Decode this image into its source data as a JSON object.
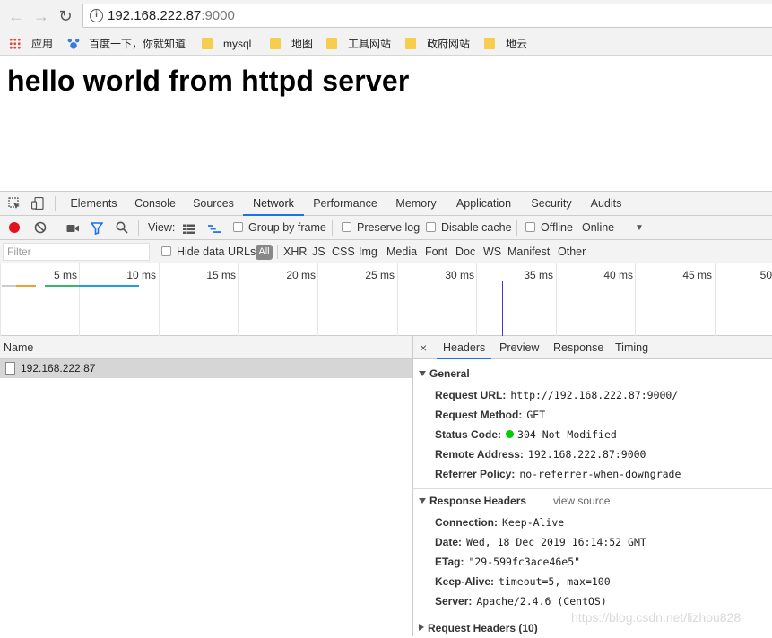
{
  "browser": {
    "url_host": "192.168.222.87",
    "url_port": ":9000",
    "bookmarks": [
      {
        "label": "应用",
        "icon": "apps-grid-icon"
      },
      {
        "label": "百度一下，你就知道",
        "icon": "baidu-paw-icon"
      },
      {
        "label": "mysql",
        "icon": "folder-icon"
      },
      {
        "label": "地图",
        "icon": "folder-icon"
      },
      {
        "label": "工具网站",
        "icon": "folder-icon"
      },
      {
        "label": "政府网站",
        "icon": "folder-icon"
      },
      {
        "label": "地云",
        "icon": "folder-icon"
      }
    ]
  },
  "page": {
    "heading": "hello world from httpd server"
  },
  "devtools": {
    "tabs": [
      "Elements",
      "Console",
      "Sources",
      "Network",
      "Performance",
      "Memory",
      "Application",
      "Security",
      "Audits"
    ],
    "active_tab": "Network",
    "toolbar": {
      "view_label": "View:",
      "group_by_frame": "Group by frame",
      "preserve_log": "Preserve log",
      "disable_cache": "Disable cache",
      "offline": "Offline",
      "throttle": "Online"
    },
    "filter": {
      "placeholder": "Filter",
      "hide_data_urls": "Hide data URLs",
      "types": [
        "All",
        "XHR",
        "JS",
        "CSS",
        "Img",
        "Media",
        "Font",
        "Doc",
        "WS",
        "Manifest",
        "Other"
      ]
    },
    "timeline_ticks": [
      "5 ms",
      "10 ms",
      "15 ms",
      "20 ms",
      "25 ms",
      "30 ms",
      "35 ms",
      "40 ms",
      "45 ms",
      "50"
    ],
    "requests": {
      "column_name": "Name",
      "rows": [
        "192.168.222.87"
      ]
    },
    "detail": {
      "tabs": [
        "Headers",
        "Preview",
        "Response",
        "Timing"
      ],
      "active_tab": "Headers",
      "close_glyph": "×",
      "general": {
        "title": "General",
        "items": [
          {
            "k": "Request URL:",
            "v": "http://192.168.222.87:9000/"
          },
          {
            "k": "Request Method:",
            "v": "GET"
          },
          {
            "k": "Status Code:",
            "v": "304 Not Modified"
          },
          {
            "k": "Remote Address:",
            "v": "192.168.222.87:9000"
          },
          {
            "k": "Referrer Policy:",
            "v": "no-referrer-when-downgrade"
          }
        ]
      },
      "response_headers": {
        "title": "Response Headers",
        "view_source": "view source",
        "items": [
          {
            "k": "Connection:",
            "v": "Keep-Alive"
          },
          {
            "k": "Date:",
            "v": "Wed, 18 Dec 2019 16:14:52 GMT"
          },
          {
            "k": "ETag:",
            "v": "\"29-599fc3ace46e5\""
          },
          {
            "k": "Keep-Alive:",
            "v": "timeout=5, max=100"
          },
          {
            "k": "Server:",
            "v": "Apache/2.4.6 (CentOS)"
          }
        ]
      },
      "request_headers": {
        "title": "Request Headers (10)"
      }
    },
    "colors": {
      "accent": "#1a73e8",
      "status_ok": "#00cc00",
      "record": "#e0131e"
    }
  },
  "watermark": "https://blog.csdn.net/lizhou828"
}
